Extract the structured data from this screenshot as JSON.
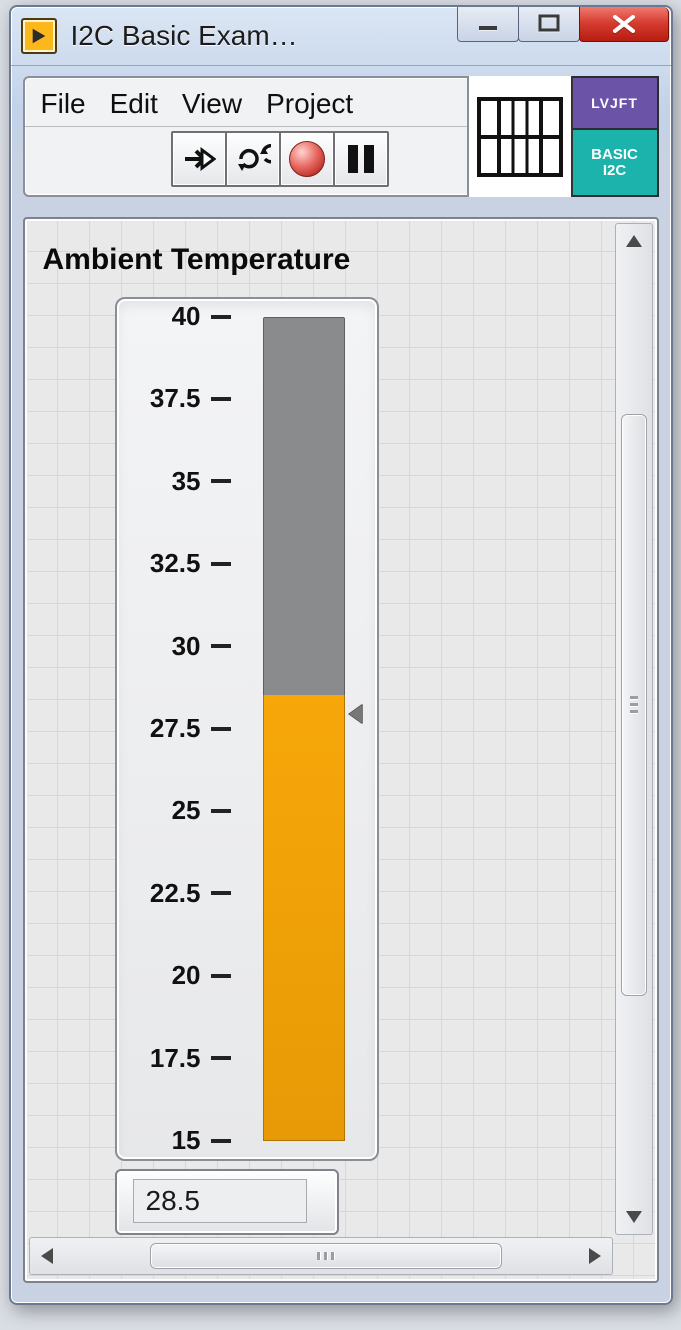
{
  "window": {
    "title": "I2C Basic Exam…"
  },
  "menu": {
    "file": "File",
    "edit": "Edit",
    "view": "View",
    "project": "Project"
  },
  "badge": {
    "lvjft": "LVJFT",
    "basic_i2c": "BASIC\nI2C"
  },
  "label": {
    "title": "Ambient Temperature"
  },
  "chart_data": {
    "type": "bar",
    "title": "Ambient Temperature",
    "ylabel": "",
    "xlabel": "",
    "ylim": [
      15,
      40
    ],
    "categories": [
      "Ambient Temperature"
    ],
    "values": [
      28.5
    ],
    "ticks": [
      40,
      37.5,
      35,
      32.5,
      30,
      27.5,
      25,
      22.5,
      20,
      17.5,
      15
    ],
    "accent": "#f7a708"
  },
  "readout": {
    "value": "28.5"
  }
}
